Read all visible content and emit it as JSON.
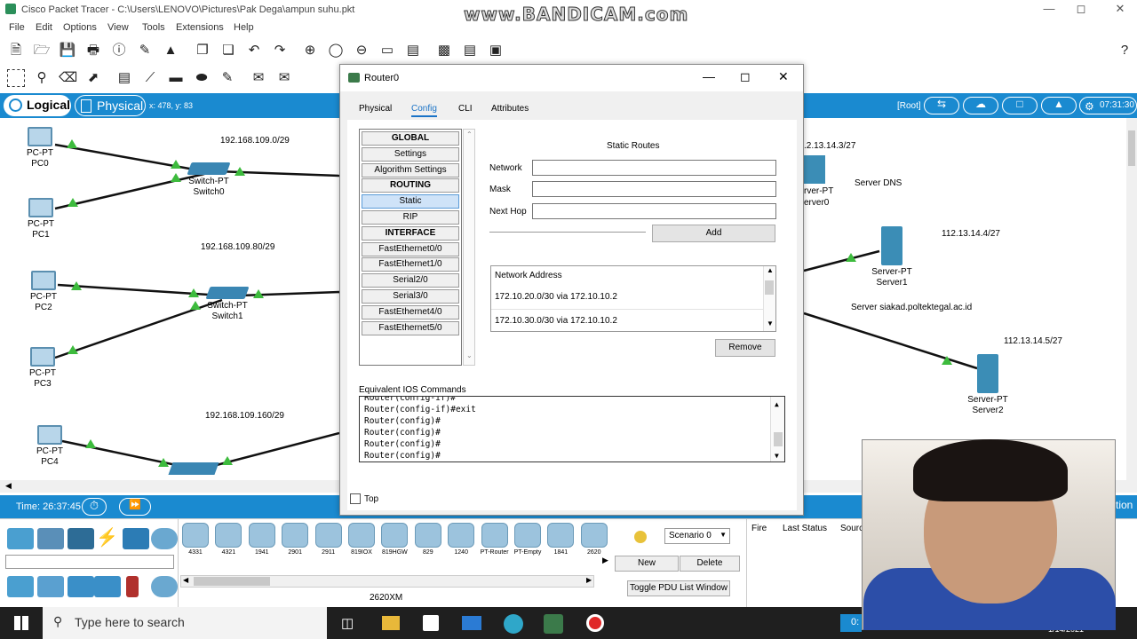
{
  "window": {
    "title": "Cisco Packet Tracer - C:\\Users\\LENOVO\\Pictures\\Pak Dega\\ampun suhu.pkt",
    "watermark": "www.BANDICAM.com"
  },
  "menu": [
    "File",
    "Edit",
    "Options",
    "View",
    "Tools",
    "Extensions",
    "Help"
  ],
  "workspace_bar": {
    "logical": "Logical",
    "physical": "Physical",
    "coords": "x: 478, y: 83",
    "root": "[Root]",
    "clock": "07:31:30"
  },
  "networks": {
    "n1": "192.168.109.0/29",
    "n2": "192.168.109.80/29",
    "n3": "192.168.109.160/29"
  },
  "devices": {
    "pc0": {
      "type": "PC-PT",
      "name": "PC0"
    },
    "pc1": {
      "type": "PC-PT",
      "name": "PC1"
    },
    "pc2": {
      "type": "PC-PT",
      "name": "PC2"
    },
    "pc3": {
      "type": "PC-PT",
      "name": "PC3"
    },
    "pc4": {
      "type": "PC-PT",
      "name": "PC4"
    },
    "sw0": {
      "type": "Switch-PT",
      "name": "Switch0"
    },
    "sw1": {
      "type": "Switch-PT",
      "name": "Switch1"
    },
    "srv0": {
      "type": "rver-PT",
      "name": "erver0",
      "ip": ".2.13.14.3/27",
      "desc": "Server DNS"
    },
    "srv1": {
      "type": "Server-PT",
      "name": "Server1",
      "ip": "112.13.14.4/27",
      "desc": "Server siakad.poltektegal.ac.id"
    },
    "srv2": {
      "type": "Server-PT",
      "name": "Server2",
      "ip": "112.13.14.5/27"
    }
  },
  "dialog": {
    "title": "Router0",
    "tabs": [
      "Physical",
      "Config",
      "CLI",
      "Attributes"
    ],
    "left_list": [
      {
        "label": "GLOBAL",
        "header": true
      },
      {
        "label": "Settings"
      },
      {
        "label": "Algorithm Settings"
      },
      {
        "label": "ROUTING",
        "header": true
      },
      {
        "label": "Static",
        "selected": true
      },
      {
        "label": "RIP"
      },
      {
        "label": "INTERFACE",
        "header": true
      },
      {
        "label": "FastEthernet0/0"
      },
      {
        "label": "FastEthernet1/0"
      },
      {
        "label": "Serial2/0"
      },
      {
        "label": "Serial3/0"
      },
      {
        "label": "FastEthernet4/0"
      },
      {
        "label": "FastEthernet5/0"
      }
    ],
    "static_routes": {
      "heading": "Static Routes",
      "network_label": "Network",
      "network_value": "",
      "mask_label": "Mask",
      "mask_value": "",
      "nexthop_label": "Next Hop",
      "nexthop_value": "",
      "add": "Add",
      "list_header": "Network Address",
      "routes": [
        "172.10.20.0/30 via 172.10.10.2",
        "172.10.30.0/30 via 172.10.10.2"
      ],
      "remove": "Remove"
    },
    "ios_label": "Equivalent IOS Commands",
    "ios_lines": [
      "Router(config-if)#",
      "Router(config-if)#exit",
      "Router(config)#",
      "Router(config)#",
      "Router(config)#",
      "Router(config)#"
    ],
    "top_checkbox": "Top"
  },
  "bottom": {
    "time": "Time: 26:37:45",
    "models": [
      "4331",
      "4321",
      "1941",
      "2901",
      "2911",
      "819IOX",
      "819HGW",
      "829",
      "1240",
      "PT-Router",
      "PT-Empty",
      "1841",
      "2620"
    ],
    "model_caption": "2620XM",
    "scenario": "Scenario 0",
    "new": "New",
    "delete": "Delete",
    "toggle": "Toggle PDU List Window",
    "pdu_cols": [
      "Fire",
      "Last Status",
      "Sourc"
    ]
  },
  "taskbar": {
    "search": "Type here to search",
    "date": "1/14/2021"
  },
  "colors": {
    "accent": "#1a8ad0",
    "link_dot": "#3dbb3d"
  }
}
